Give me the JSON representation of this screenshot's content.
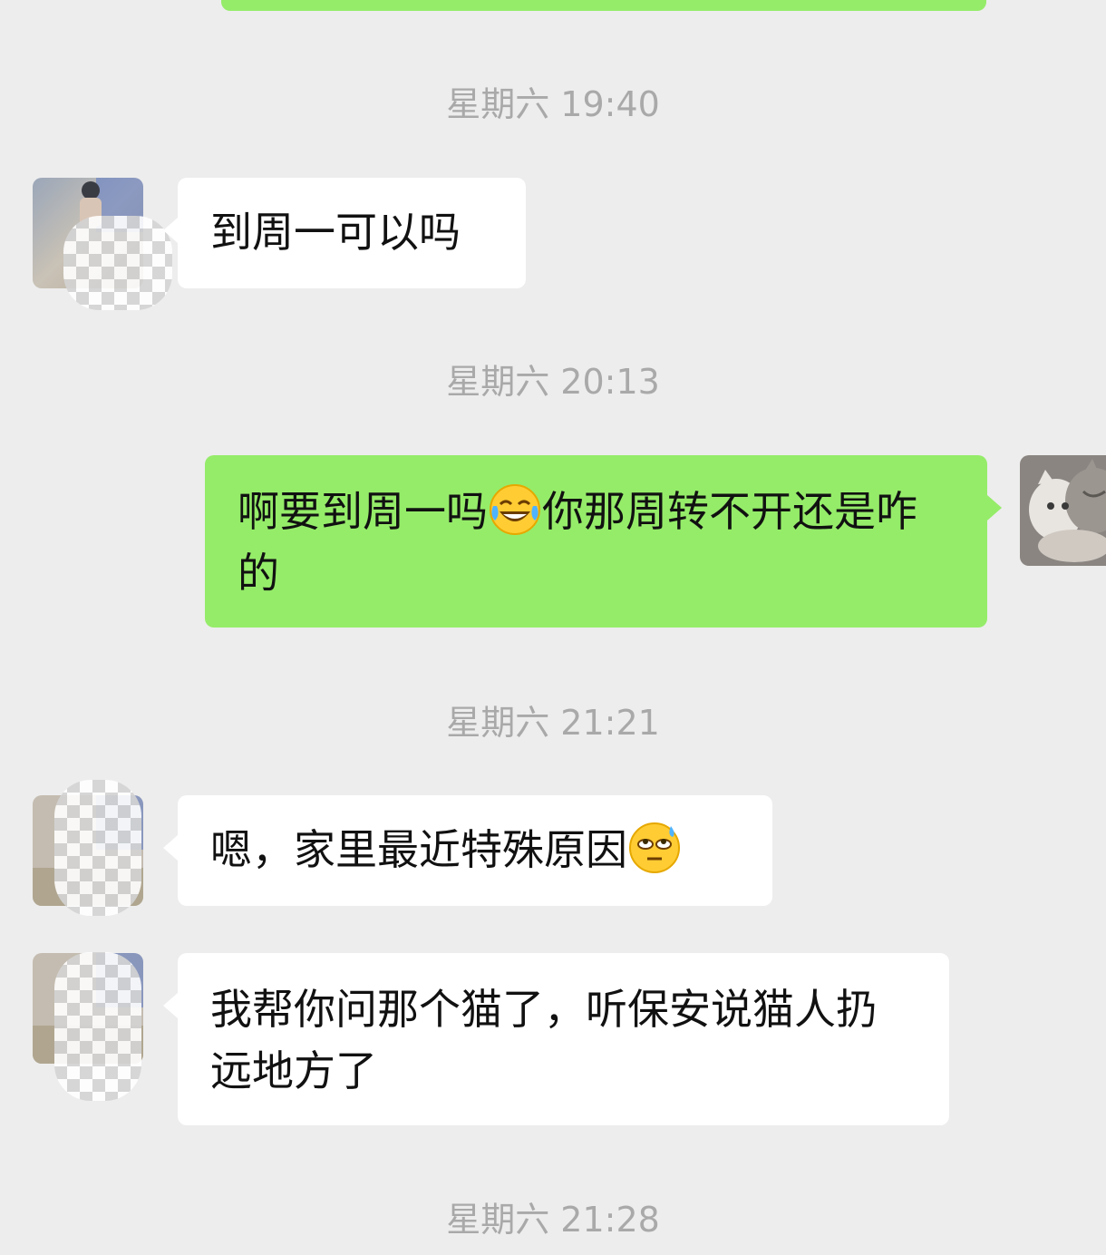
{
  "colors": {
    "background": "#ededed",
    "incoming_bubble": "#ffffff",
    "outgoing_bubble": "#95ec69",
    "timestamp_text": "#a9a9a9",
    "message_text": "#111111"
  },
  "timestamps": [
    "星期六 19:40",
    "星期六 20:13",
    "星期六 21:21",
    "星期六 21:28"
  ],
  "messages": [
    {
      "direction": "incoming",
      "text": "到周一可以吗",
      "avatar": "contact-avatar"
    },
    {
      "direction": "outgoing",
      "text_before": "啊要到周一吗",
      "emoji": "tears-of-joy-emoji",
      "text_after": "你那周转不开还是咋的",
      "avatar": "cat-avatar"
    },
    {
      "direction": "incoming",
      "text": "嗯，家里最近特殊原因",
      "emoji": "sweat-eye-roll-emoji",
      "avatar": "contact-avatar"
    },
    {
      "direction": "incoming",
      "text": "我帮你问那个猫了，听保安说猫人扔远地方了",
      "avatar": "contact-avatar"
    }
  ]
}
